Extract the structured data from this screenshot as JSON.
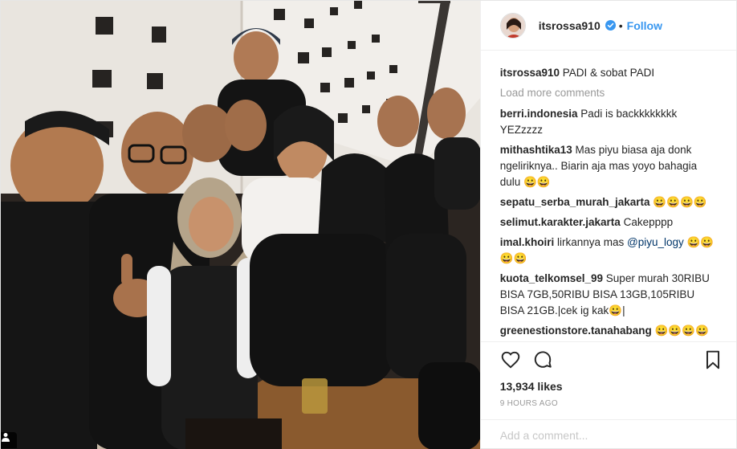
{
  "post": {
    "username": "itsrossa910",
    "follow_label": "Follow",
    "dot": "•",
    "caption": {
      "user": "itsrossa910",
      "text": "PADI & sobat PADI"
    },
    "load_more_label": "Load more comments",
    "comments": [
      {
        "user": "berri.indonesia",
        "text": "Padi is backkkkkkkk YEZzzzz"
      },
      {
        "user": "mithashtika13",
        "text": "Mas piyu biasa aja donk ngeliriknya.. Biarin aja mas yoyo bahagia dulu 😀😀"
      },
      {
        "user": "sepatu_serba_murah_jakarta",
        "text": "😀😀😀😀"
      },
      {
        "user": "selimut.karakter.jakarta",
        "text": "Cakepppp"
      },
      {
        "user": "imal.khoiri",
        "text": "lirkannya mas",
        "mention": "@piyu_logy",
        "after": "😀😀😀😀"
      },
      {
        "user": "kuota_telkomsel_99",
        "text": "Super murah 30RIBU BISA 7GB,50RIBU BISA 13GB,105RIBU BISA 21GB.|cek ig kak😀|"
      },
      {
        "user": "greenestionstore.tanahabang",
        "text": "😀😀😀😀"
      }
    ],
    "likes": "13,934 likes",
    "timestamp": "9 HOURS AGO",
    "comment_placeholder": "Add a comment..."
  },
  "icons": {
    "verified": "verified-badge-icon",
    "like": "heart-icon",
    "comment": "speech-bubble-icon",
    "save": "bookmark-icon",
    "tag": "person-tag-icon"
  },
  "colors": {
    "link_blue": "#3897f0",
    "verified_blue": "#3897f0",
    "muted_gray": "#999999",
    "mention_blue": "#003569"
  }
}
